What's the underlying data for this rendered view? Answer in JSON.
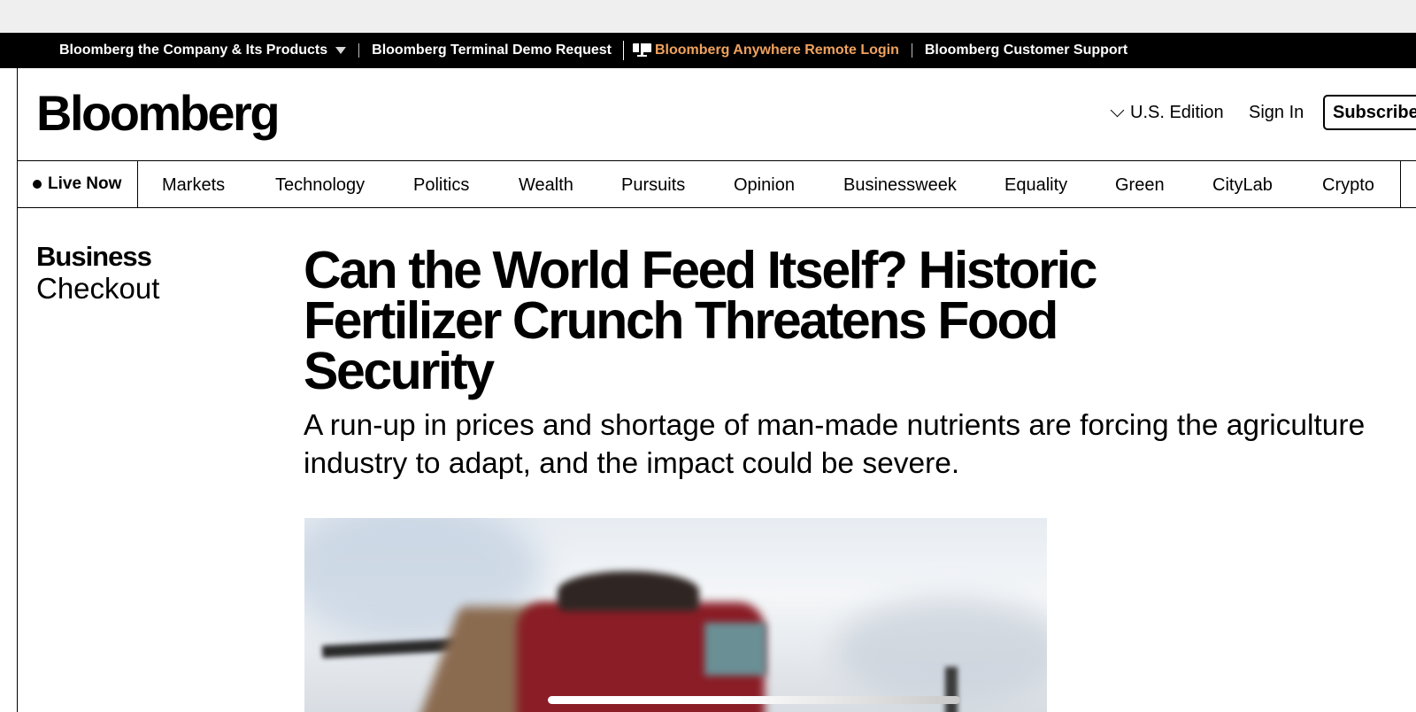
{
  "topbar": {
    "company_products": "Bloomberg the Company & Its Products",
    "terminal_demo": "Bloomberg Terminal Demo Request",
    "anywhere_login": "Bloomberg Anywhere Remote Login",
    "customer_support": "Bloomberg Customer Support",
    "accent_color": "#f0a25e"
  },
  "header": {
    "logo": "Bloomberg",
    "edition": "U.S. Edition",
    "sign_in": "Sign In",
    "subscribe": "Subscribe"
  },
  "nav": {
    "live_now": "Live Now",
    "items": [
      "Markets",
      "Technology",
      "Politics",
      "Wealth",
      "Pursuits",
      "Opinion",
      "Businessweek",
      "Equality",
      "Green",
      "CityLab",
      "Crypto"
    ]
  },
  "article": {
    "section_primary": "Business",
    "section_secondary": "Checkout",
    "headline": "Can the World Feed Itself? Historic Fertilizer Crunch Threatens Food Security",
    "dek": "A run-up in prices and shortage of man-made nutrients are forcing the agriculture industry to adapt, and the impact could be severe."
  }
}
